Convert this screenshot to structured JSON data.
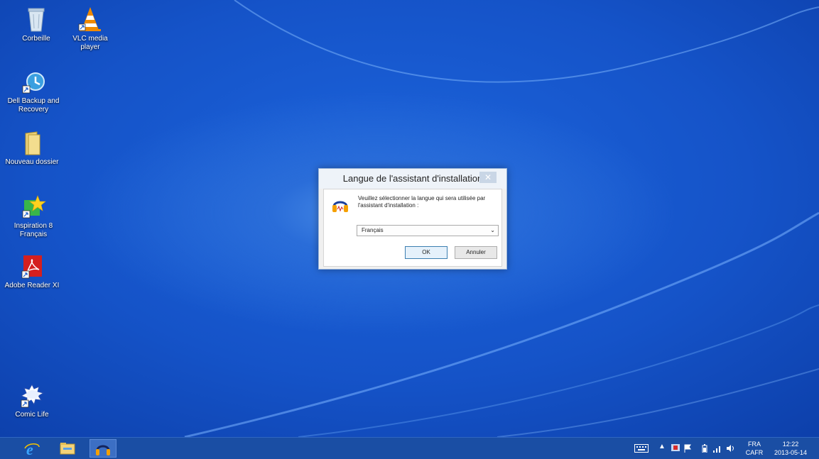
{
  "desktop": {
    "icons": [
      {
        "label": "Corbeille",
        "icon": "recycle-bin-icon"
      },
      {
        "label": "VLC media player",
        "icon": "vlc-cone-icon"
      },
      {
        "label": "Dell Backup and Recovery",
        "icon": "dell-backup-icon"
      },
      {
        "label": "Nouveau dossier",
        "icon": "folder-icon"
      },
      {
        "label": "Inspiration 8 Français",
        "icon": "inspiration-star-icon"
      },
      {
        "label": "Adobe Reader XI",
        "icon": "adobe-reader-icon"
      },
      {
        "label": "Comic Life",
        "icon": "comic-life-icon"
      }
    ]
  },
  "dialog": {
    "title": "Langue de l'assistant d'installation",
    "close_label": "✕",
    "prompt": "Veuillez sélectionner la langue qui sera utilisée par l'assistant d'installation :",
    "language_value": "Français",
    "ok_label": "OK",
    "cancel_label": "Annuler"
  },
  "taskbar": {
    "pinned": [
      "internet-explorer-icon",
      "file-explorer-icon",
      "audacity-icon"
    ],
    "language_top": "FRA",
    "language_bottom": "CAFR",
    "time": "12:22",
    "date": "2013-05-14"
  },
  "colors": {
    "desktop_blue": "#1553c8",
    "taskbar_blue": "#1a4ea4",
    "dialog_bg": "#f0f0f0"
  }
}
